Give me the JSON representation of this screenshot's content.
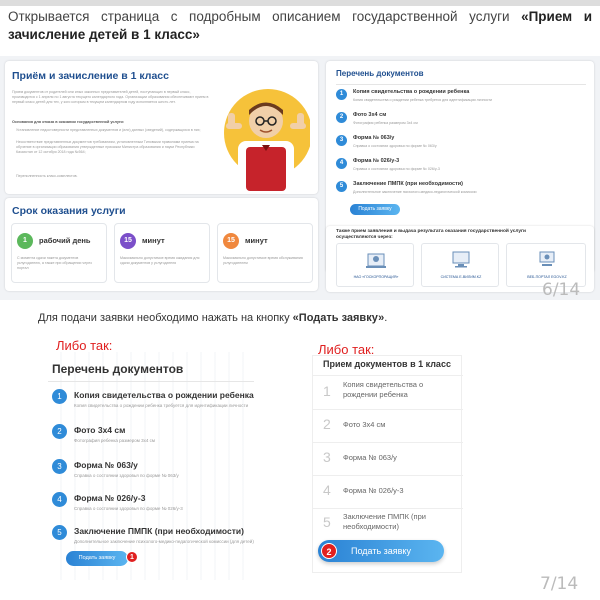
{
  "intro": {
    "text": "Открывается страница с подробным описанием государственной услуги ",
    "bold": "«Прием и зачисление детей в 1 класс»"
  },
  "slide1": {
    "service_title": "Приём и зачисление в 1 класс",
    "service_desc": "Прием документов от родителей или иных законных представителей детей, поступающих в первый класс, производится с 1 апреля по 1 августа текущего календарного года. Организации образования обеспечивают прием в первый класс детей для тех, у кого которым в текущем календарном году исполняется шесть лет.",
    "refusal_title": "Основания для отказа в оказании государственной услуги:",
    "refusal_items": [
      "Установление недостоверности представленных документов и (или) данных (сведений), содержащихся в них;",
      "Несоответствие представленных документов требованиям, установленным Типовыми правилами приема на обучение в организации образования утвержденные приказом Министра образования и науки Республики Казахстан от 12 октября 2018 года №564;",
      "Переполненность класс-комплектов."
    ],
    "term_title": "Срок оказания услуги",
    "terms": [
      {
        "num": "1",
        "label": "рабочий день",
        "desc": "С момента сдачи пакета документов услугодателю, а также при обращении через портал",
        "color": "#5cb85c"
      },
      {
        "num": "15",
        "label": "минут",
        "desc": "Максимально допустимое время ожидания для сдачи документов у услугодателя",
        "color": "#7b4fc9"
      },
      {
        "num": "15",
        "label": "минут",
        "desc": "Максимально допустимое время обслуживания услугодателем",
        "color": "#f0883e"
      }
    ],
    "docs_title": "Перечень документов",
    "docs": [
      {
        "n": "1",
        "title": "Копия свидетельства о рождении ребенка",
        "sub": "Копия свидетельства о рождении ребенка требуется для идентификации личности"
      },
      {
        "n": "2",
        "title": "Фото 3х4 см",
        "sub": "Фотография ребенка размером 3х4 см"
      },
      {
        "n": "3",
        "title": "Форма № 063/у",
        "sub": "Справка о состоянии здоровья по форме № 063/у"
      },
      {
        "n": "4",
        "title": "Форма № 026/у-3",
        "sub": "Справка о состоянии здоровья по форме № 026/у-3"
      },
      {
        "n": "5",
        "title": "Заключение ПМПК (при необходимости)",
        "sub": "Дополнительное заключение психолого-медико-педагогической комиссии"
      }
    ],
    "apply_btn": "Подать заявку",
    "channels_title": "Также прием заявления и выдача результата оказания государственной услуги осуществляются через:",
    "channels": [
      "НАО «ГОСКОРПОРАЦИЯ»",
      "СИСТЕМА Е-ВИЛИМ.KZ",
      "ВЕБ-ПОРТАЛ EGOV.KZ"
    ],
    "page": "6/14"
  },
  "instruction": {
    "text": "Для подачи заявки необходимо нажать на кнопку ",
    "bold": "«Подать заявку»",
    "end": "."
  },
  "left": {
    "label": "Либо так:",
    "title": "Перечень документов",
    "docs": [
      {
        "n": "1",
        "title": "Копия свидетельства о рождении ребенка",
        "sub": "Копия свидетельства о рождении ребенка требуется для идентификации личности"
      },
      {
        "n": "2",
        "title": "Фото 3х4 см",
        "sub": "Фотография ребенка размером 3х4 см"
      },
      {
        "n": "3",
        "title": "Форма № 063/у",
        "sub": "Справка о состоянии здоровья по форме № 063/у"
      },
      {
        "n": "4",
        "title": "Форма № 026/у-3",
        "sub": "Справка о состоянии здоровья по форме № 026/у-3"
      },
      {
        "n": "5",
        "title": "Заключение ПМПК (при необходимости)",
        "sub": "Дополнительное заключение психолого-медико-педагогической комиссии (для детей)"
      }
    ],
    "btn": "Подать заявку",
    "marker": "1"
  },
  "right": {
    "label": "Либо так:",
    "title": "Прием документов в 1 класс",
    "docs": [
      {
        "n": "1",
        "title": "Копия свидетельства о рождении ребенка"
      },
      {
        "n": "2",
        "title": "Фото 3х4 см"
      },
      {
        "n": "3",
        "title": "Форма № 063/у"
      },
      {
        "n": "4",
        "title": "Форма № 026/у-3"
      },
      {
        "n": "5",
        "title": "Заключение ПМПК (при необходимости)"
      }
    ],
    "btn": "Подать заявку",
    "marker": "2"
  },
  "page2": "7/14",
  "colors": {
    "accent": "#2f8bd8",
    "red": "#e02020",
    "dark_blue": "#1f4f8f"
  }
}
